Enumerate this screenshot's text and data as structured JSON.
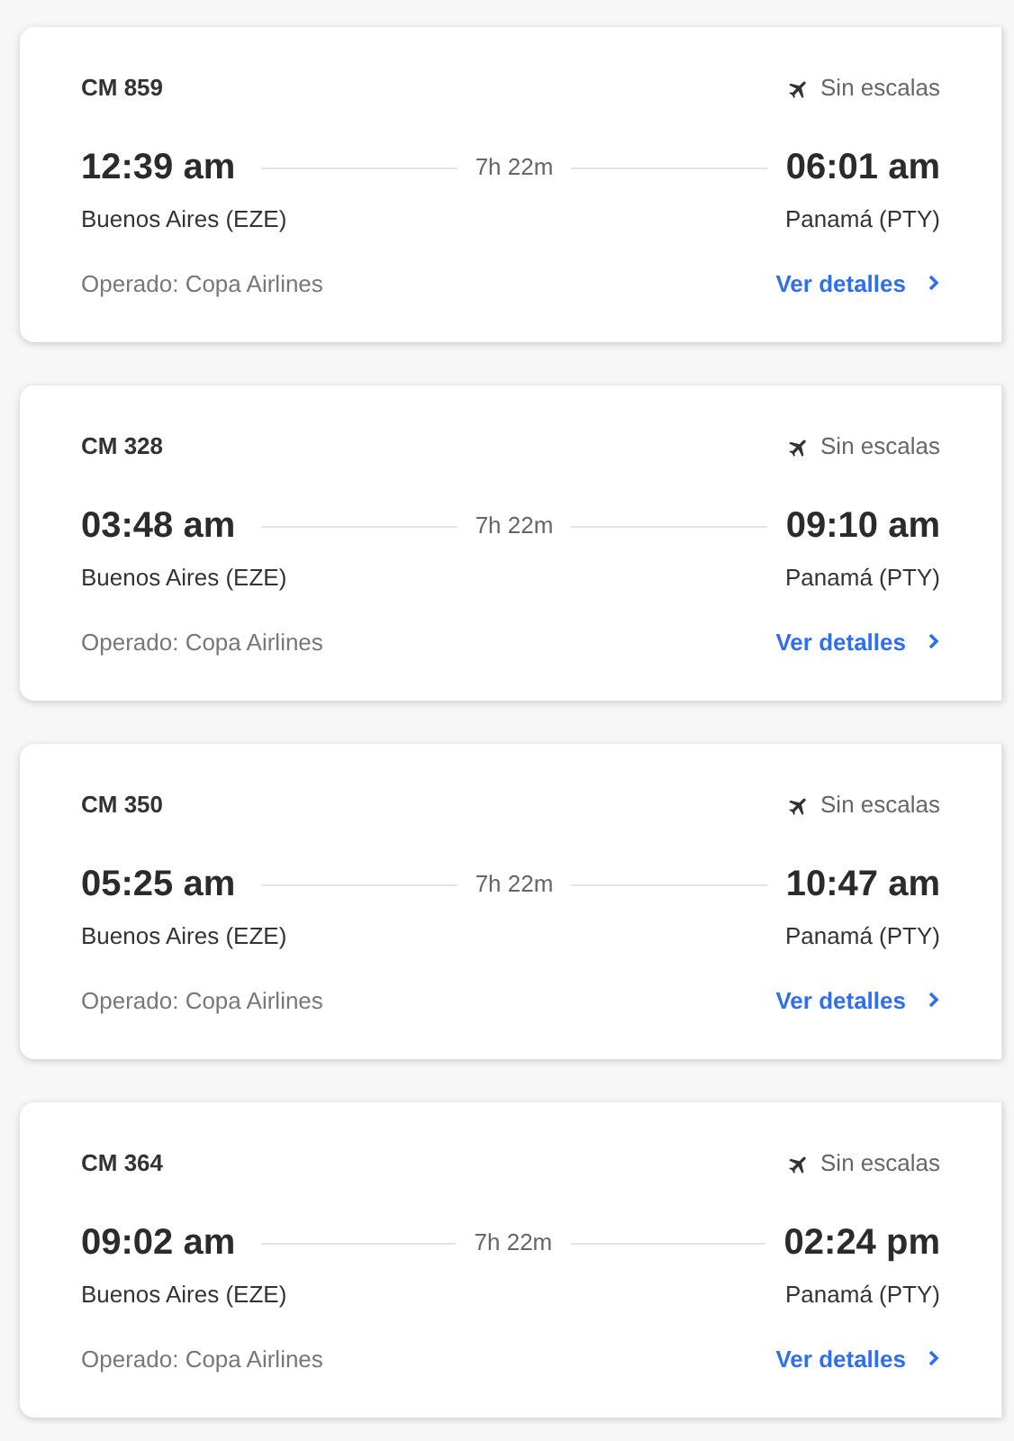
{
  "flights": [
    {
      "number": "CM 859",
      "stops": "Sin escalas",
      "departure_time": "12:39 am",
      "duration": "7h 22m",
      "arrival_time": "06:01 am",
      "origin": "Buenos Aires (EZE)",
      "destination": "Panamá (PTY)",
      "operator": "Operado: Copa Airlines",
      "details_link": "Ver detalles"
    },
    {
      "number": "CM 328",
      "stops": "Sin escalas",
      "departure_time": "03:48 am",
      "duration": "7h 22m",
      "arrival_time": "09:10 am",
      "origin": "Buenos Aires (EZE)",
      "destination": "Panamá (PTY)",
      "operator": "Operado: Copa Airlines",
      "details_link": "Ver detalles"
    },
    {
      "number": "CM 350",
      "stops": "Sin escalas",
      "departure_time": "05:25 am",
      "duration": "7h 22m",
      "arrival_time": "10:47 am",
      "origin": "Buenos Aires (EZE)",
      "destination": "Panamá (PTY)",
      "operator": "Operado: Copa Airlines",
      "details_link": "Ver detalles"
    },
    {
      "number": "CM 364",
      "stops": "Sin escalas",
      "departure_time": "09:02 am",
      "duration": "7h 22m",
      "arrival_time": "02:24 pm",
      "origin": "Buenos Aires (EZE)",
      "destination": "Panamá (PTY)",
      "operator": "Operado: Copa Airlines",
      "details_link": "Ver detalles"
    }
  ]
}
